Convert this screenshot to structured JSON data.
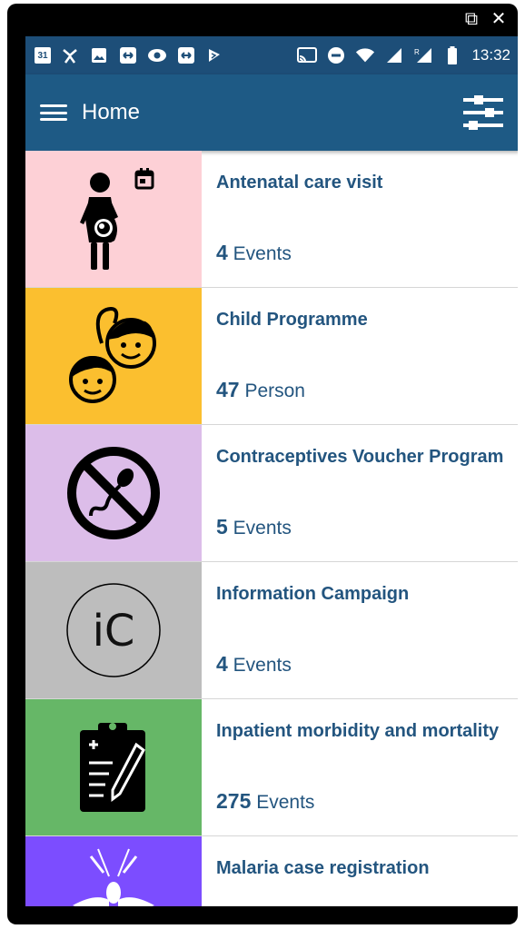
{
  "window": {
    "external_icon": "external-link-icon",
    "close_icon": "close-icon",
    "close_glyph": "✕",
    "external_glyph": "⧉"
  },
  "statusbar": {
    "calendar_day": "31",
    "time": "13:32",
    "left_icons": [
      "calendar-icon",
      "wifi-person-icon",
      "image-icon",
      "sync-icon",
      "eye-icon",
      "sync-icon",
      "flag-icon"
    ],
    "right_icons": [
      "cast-icon",
      "dnd-icon",
      "wifi-icon",
      "signal-icon",
      "signal-roaming-icon",
      "battery-icon"
    ]
  },
  "appbar": {
    "title": "Home",
    "menu_icon": "hamburger-icon",
    "filter_icon": "filter-sliders-icon"
  },
  "colors": {
    "statusbar": "#1d4e78",
    "appbar": "#1e5a85",
    "text_primary": "#23557f"
  },
  "programs": [
    {
      "name": "Antenatal care visit",
      "count": "4",
      "unit": "Events",
      "bg": "#fdd0d6",
      "icon": "pregnant-woman-calendar-icon"
    },
    {
      "name": "Child Programme",
      "count": "47",
      "unit": "Person",
      "bg": "#fbbf2f",
      "icon": "children-faces-icon"
    },
    {
      "name": "Contraceptives Voucher Program",
      "count": "5",
      "unit": "Events",
      "bg": "#dcbde9",
      "icon": "no-sperm-icon"
    },
    {
      "name": "Information Campaign",
      "count": "4",
      "unit": "Events",
      "bg": "#bdbdbd",
      "icon": "ic-circle-icon"
    },
    {
      "name": "Inpatient morbidity and mortality",
      "count": "275",
      "unit": "Events",
      "bg": "#66b767",
      "icon": "clipboard-pencil-icon"
    },
    {
      "name": "Malaria case registration",
      "count": "",
      "unit": "",
      "bg": "#7c4dff",
      "icon": "mosquito-icon"
    }
  ],
  "ic_text": "iC"
}
